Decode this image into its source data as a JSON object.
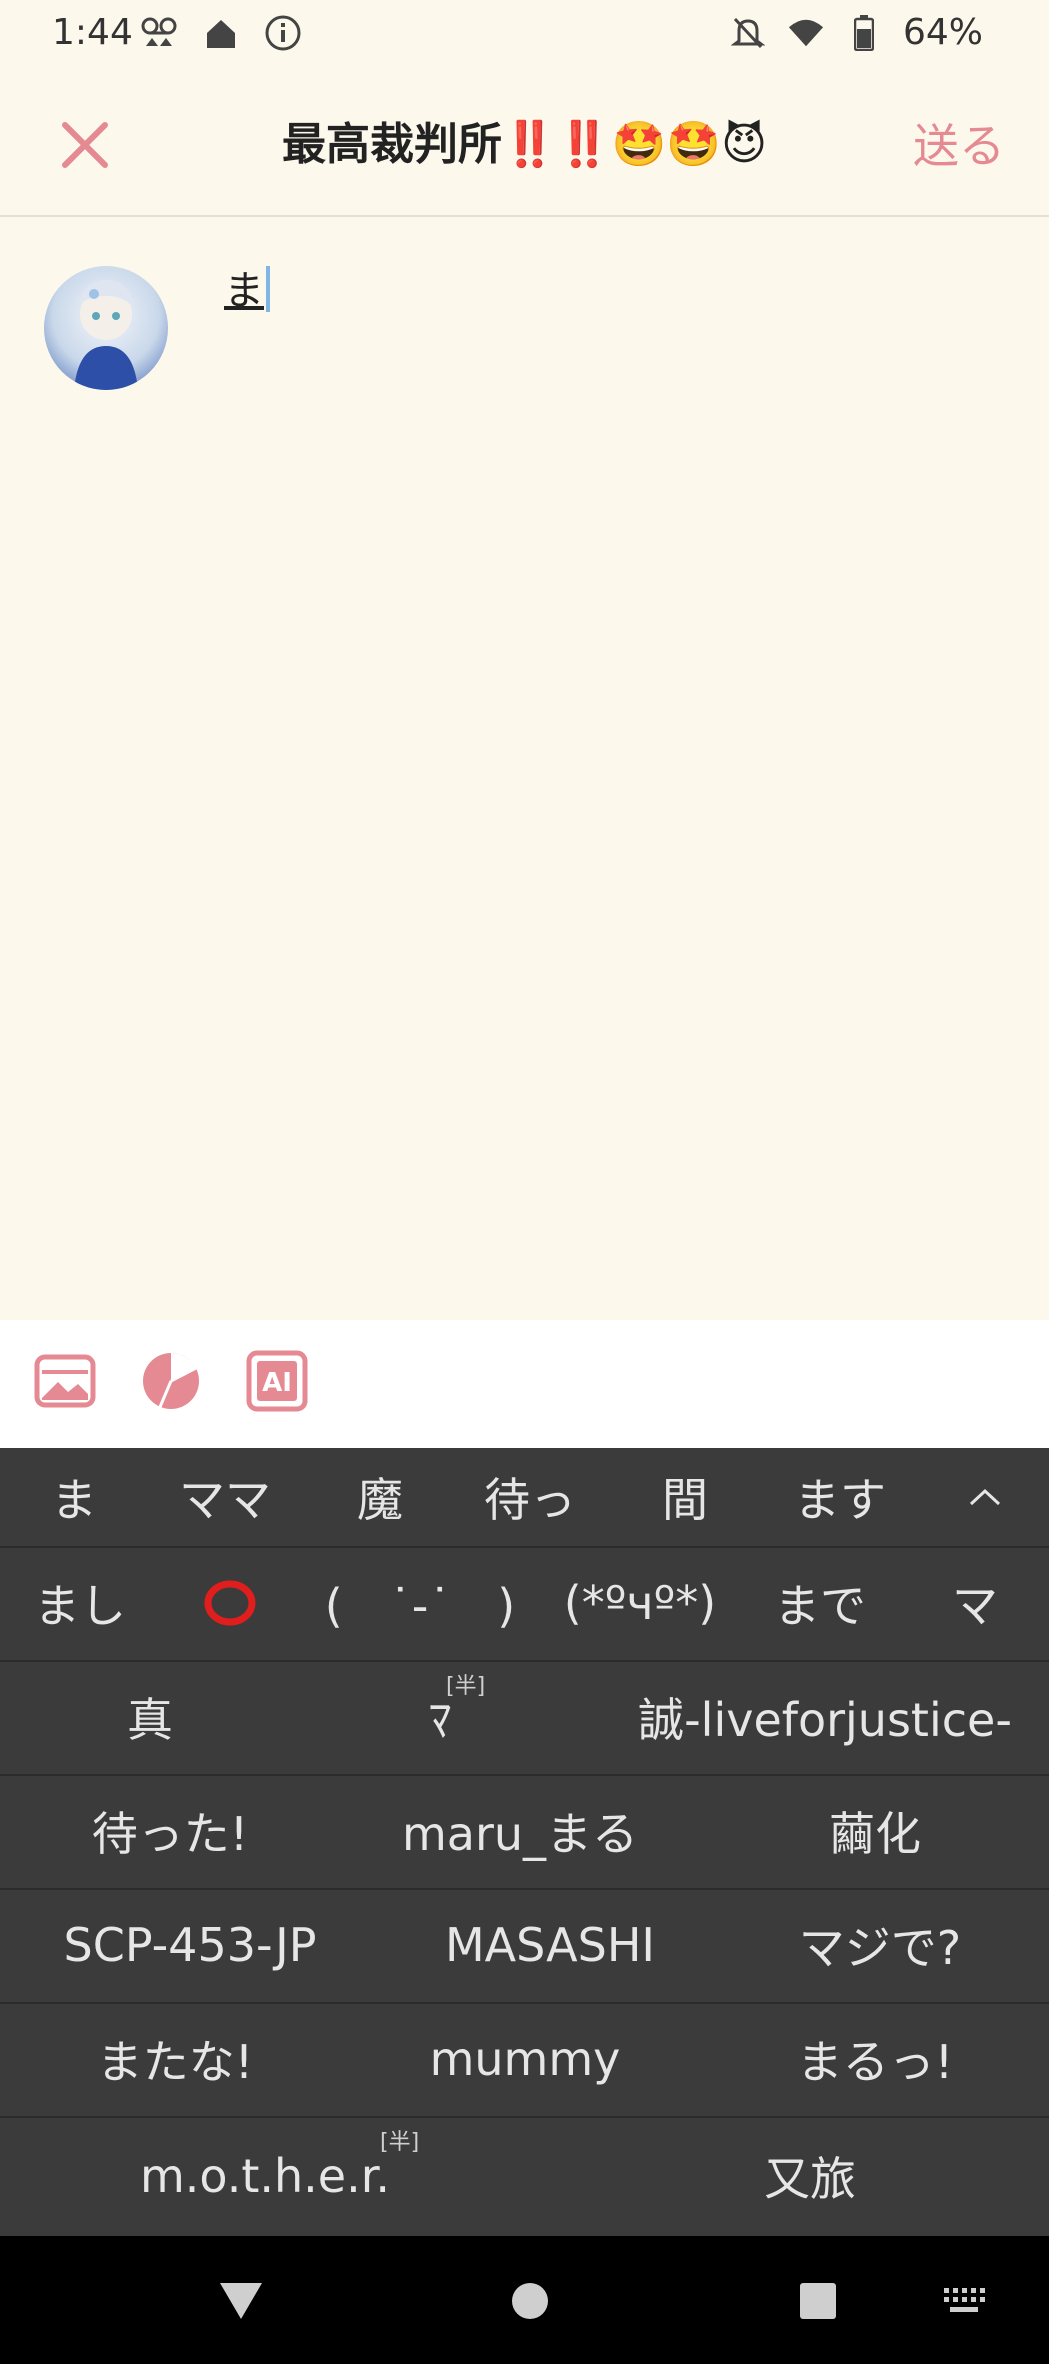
{
  "status_bar": {
    "time": "1:44",
    "battery": "64%",
    "icons_left": [
      "voicemail-icon",
      "home-icon",
      "info-icon"
    ],
    "icons_right": [
      "notifications-off-icon",
      "wifi-icon",
      "battery-icon"
    ]
  },
  "header": {
    "title": "最高裁判所‼️‼️🤩🤩😈",
    "send_label": "送る",
    "accent_color": "#e58a92"
  },
  "compose": {
    "text": "ま"
  },
  "toolbar": {
    "icons": [
      "image-icon",
      "pie-chart-icon",
      "ai-icon"
    ]
  },
  "keyboard": {
    "row1": [
      "ま",
      "ママ",
      "魔",
      "待っ",
      "間",
      "ます"
    ],
    "row2": [
      "まし",
      "⭕",
      "(　˙-˙　)",
      "(*ºчº*)",
      "まで",
      "マ"
    ],
    "row3": [
      "真",
      "ﾏ",
      "誠-liveforjustice-"
    ],
    "row4": [
      "待った!",
      "maru_まる",
      "繭化"
    ],
    "row5": [
      "SCP-453-JP",
      "MASASHI",
      "マジで?"
    ],
    "row6": [
      "またな!",
      "mummy",
      "まるっ!"
    ],
    "row7": [
      "m.o.t.h.e.r.",
      "又旅"
    ],
    "half_badge": "[半]"
  }
}
